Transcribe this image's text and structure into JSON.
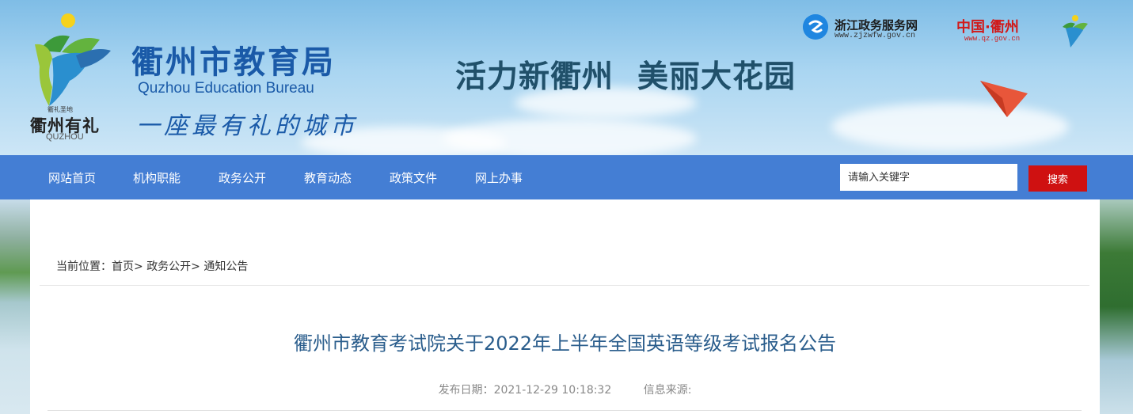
{
  "header": {
    "emblem_label": "衢礼圣地",
    "emblem_name": "衢州有礼",
    "emblem_en": "QUZHOU",
    "title": "衢州市教育局",
    "subtitle": "Quzhou Education Bureau",
    "slogan": "一座最有礼的城市",
    "banner_slogan_1": "活力新衢州",
    "banner_slogan_2": "美丽大花园",
    "links": {
      "zj_name": "浙江政务服务网",
      "zj_url": "www.zjzwfw.gov.cn",
      "qz_name": "中国·衢州",
      "qz_url": "www.qz.gov.cn"
    }
  },
  "nav": {
    "items": [
      {
        "label": "网站首页"
      },
      {
        "label": "机构职能"
      },
      {
        "label": "政务公开"
      },
      {
        "label": "教育动态"
      },
      {
        "label": "政策文件"
      },
      {
        "label": "网上办事"
      }
    ],
    "search_placeholder": "请输入关键字",
    "search_button": "搜索"
  },
  "breadcrumb": {
    "prefix": "当前位置：",
    "items": [
      "首页>",
      "政务公开>",
      "通知公告"
    ]
  },
  "article": {
    "title": "衢州市教育考试院关于2022年上半年全国英语等级考试报名公告",
    "publish_label": "发布日期：",
    "publish_date": "2021-12-29 10:18:32",
    "source_label": "信息来源:",
    "source": ""
  },
  "colors": {
    "nav_bg": "#447ed4",
    "search_button": "#cf1111",
    "title_blue": "#1a5aa8",
    "article_title": "#2a5d8c"
  }
}
